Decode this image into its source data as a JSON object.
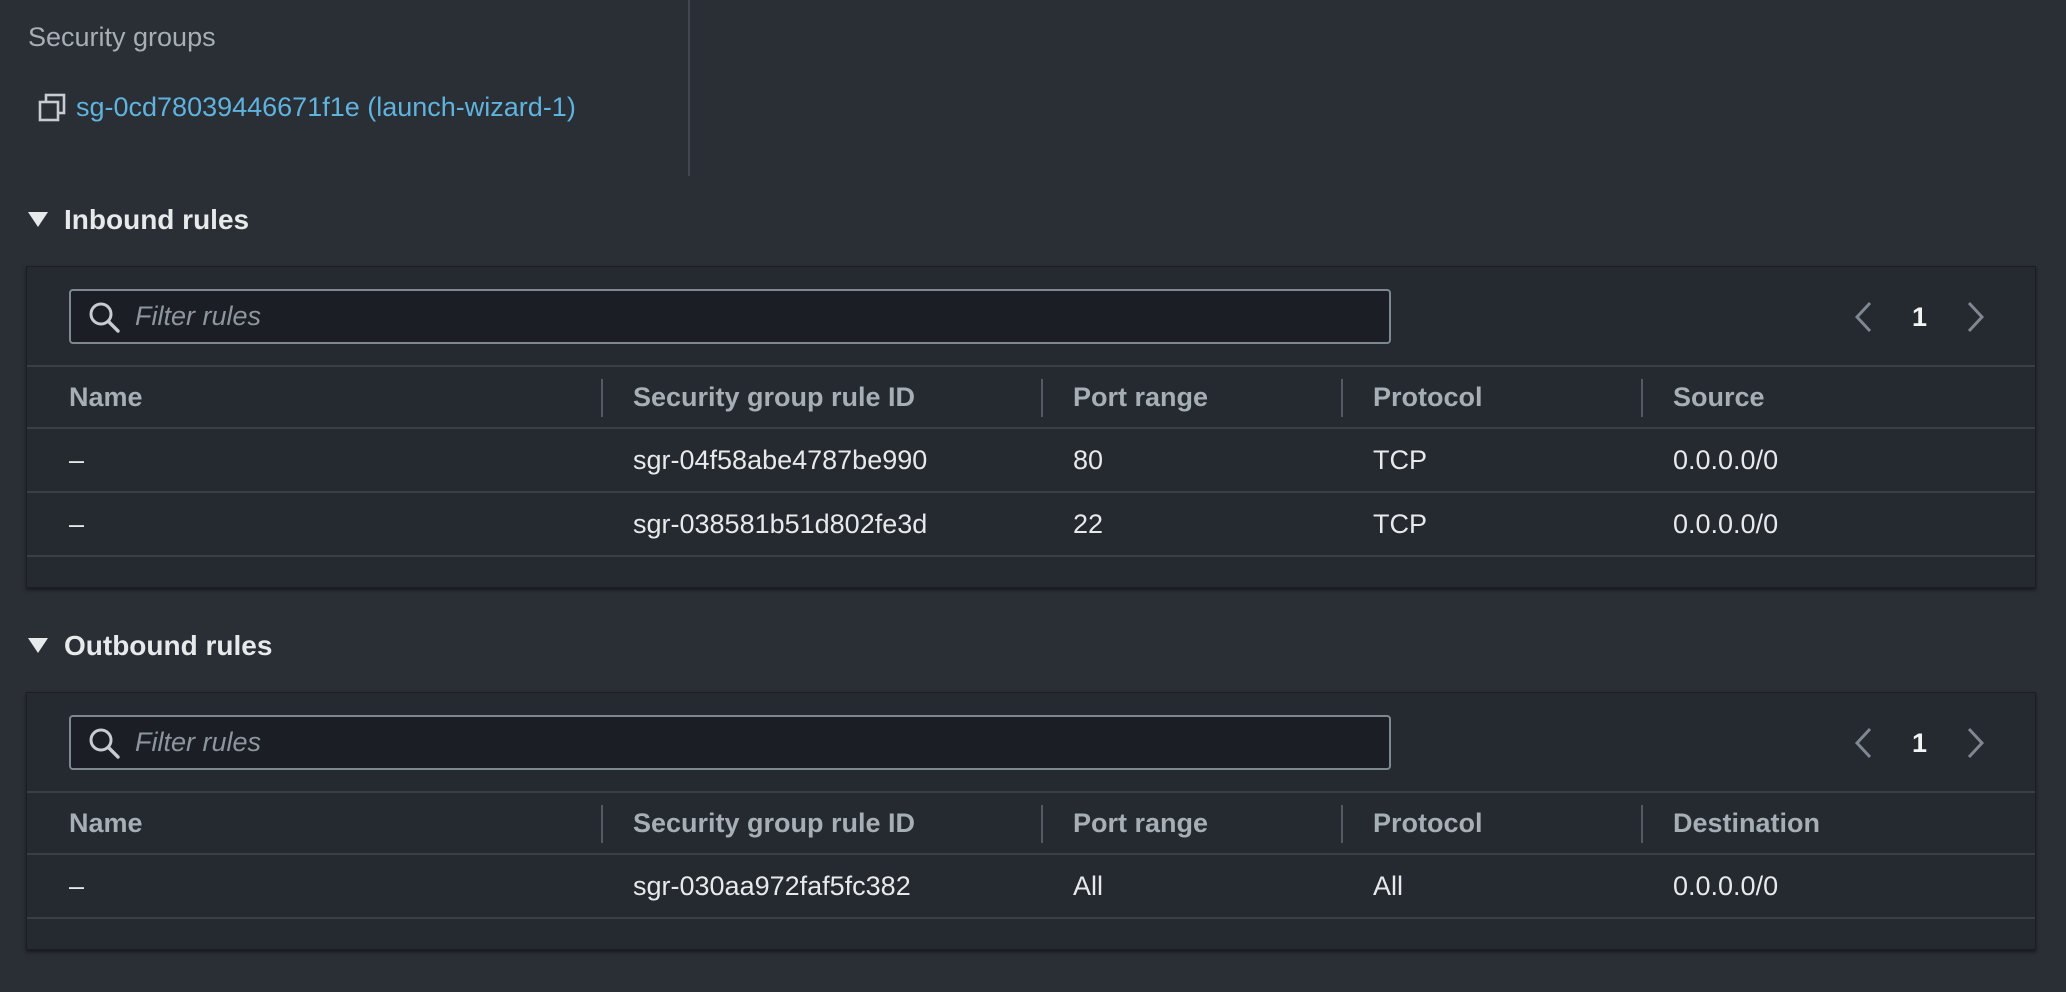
{
  "security_groups": {
    "label": "Security groups",
    "link_text": "sg-0cd78039446671f1e (launch-wizard-1)",
    "link_color": "#5fb3de"
  },
  "inbound": {
    "title": "Inbound rules",
    "filter_placeholder": "Filter rules",
    "page": "1",
    "columns": [
      "Name",
      "Security group rule ID",
      "Port range",
      "Protocol",
      "Source"
    ],
    "rows": [
      [
        "–",
        "sgr-04f58abe4787be990",
        "80",
        "TCP",
        "0.0.0.0/0"
      ],
      [
        "–",
        "sgr-038581b51d802fe3d",
        "22",
        "TCP",
        "0.0.0.0/0"
      ]
    ]
  },
  "outbound": {
    "title": "Outbound rules",
    "filter_placeholder": "Filter rules",
    "page": "1",
    "columns": [
      "Name",
      "Security group rule ID",
      "Port range",
      "Protocol",
      "Destination"
    ],
    "rows": [
      [
        "–",
        "sgr-030aa972faf5fc382",
        "All",
        "All",
        "0.0.0.0/0"
      ]
    ]
  },
  "icons": {
    "copy": "copy-icon",
    "caret": "caret-down-icon",
    "search": "search-icon",
    "prev": "chevron-left-icon",
    "next": "chevron-right-icon"
  },
  "colors": {
    "background": "#2a2e35",
    "panel": "#252930",
    "link": "#5fb3de"
  }
}
